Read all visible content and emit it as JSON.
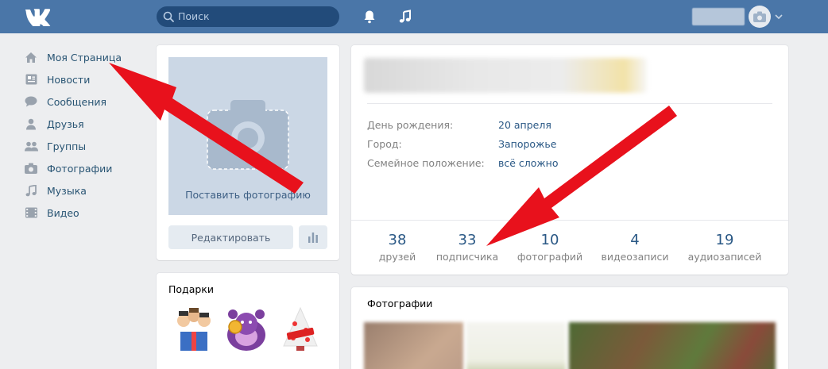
{
  "header": {
    "search_placeholder": "Поиск",
    "brand_color": "#4a76a8",
    "icons": [
      "vk-logo-icon",
      "search-icon",
      "bell-icon",
      "music-icon",
      "camera-icon",
      "chevron-down-icon"
    ]
  },
  "sidebar": {
    "items": [
      {
        "label": "Моя Страница",
        "icon": "home-icon"
      },
      {
        "label": "Новости",
        "icon": "news-icon"
      },
      {
        "label": "Сообщения",
        "icon": "messages-icon"
      },
      {
        "label": "Друзья",
        "icon": "friends-icon"
      },
      {
        "label": "Группы",
        "icon": "groups-icon"
      },
      {
        "label": "Фотографии",
        "icon": "photos-icon"
      },
      {
        "label": "Музыка",
        "icon": "music-icon"
      },
      {
        "label": "Видео",
        "icon": "video-icon"
      }
    ]
  },
  "profile_photo": {
    "caption": "Поставить фотографию",
    "edit_label": "Редактировать"
  },
  "gifts": {
    "title": "Подарки"
  },
  "info": {
    "rows": [
      {
        "key": "День рождения:",
        "value": "20 апреля"
      },
      {
        "key": "Город:",
        "value": "Запорожье"
      },
      {
        "key": "Семейное положение:",
        "value": "всё сложно"
      }
    ],
    "counters": [
      {
        "num": "38",
        "label": "друзей"
      },
      {
        "num": "33",
        "label": "подписчика"
      },
      {
        "num": "10",
        "label": "фотографий"
      },
      {
        "num": "4",
        "label": "видеозаписи"
      },
      {
        "num": "19",
        "label": "аудиозаписей"
      }
    ]
  },
  "photos": {
    "title": "Фотографии"
  },
  "annotation_color": "#e8111c"
}
